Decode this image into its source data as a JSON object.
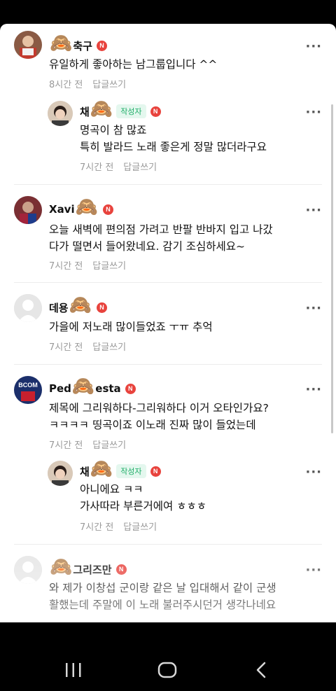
{
  "comments": [
    {
      "name_prefix": "",
      "name": "축구",
      "text": "유일하게 좋아하는 남그룹입니다 ^^",
      "time": "8시간 전",
      "reply": "답글쓰기"
    },
    {
      "name_prefix": "채",
      "name": "",
      "author_badge": "작성자",
      "text": "명곡이 참 많죠\n특히 발라드 노래 좋은게 정말 많더라구요",
      "time": "7시간 전",
      "reply": "답글쓰기"
    },
    {
      "name_prefix": "Xavi",
      "name": "",
      "text": "오늘 새벽에 편의점 가려고 반팔 반바지 입고 나갔\n다가 떨면서 들어왔네요. 감기 조심하세요~",
      "time": "7시간 전",
      "reply": "답글쓰기"
    },
    {
      "name_prefix": "데용",
      "name": "",
      "text": "가을에 저노래 많이들었죠 ㅜㅠ 추억",
      "time": "7시간 전",
      "reply": "답글쓰기"
    },
    {
      "name_prefix": "Ped",
      "name": "esta",
      "avatar_text": "BCOM",
      "text": "제목에 그리워하다-그리워하다 이거 오타인가요?\nㅋㅋㅋㅋ 띵곡이죠 이노래 진짜 많이 들었는데",
      "time": "7시간 전",
      "reply": "답글쓰기"
    },
    {
      "name_prefix": "채",
      "name": "",
      "author_badge": "작성자",
      "text": "아니에요 ㅋㅋ\n가사따라 부른거에여 ㅎㅎㅎ",
      "time": "7시간 전",
      "reply": "답글쓰기"
    },
    {
      "name_prefix": "",
      "name": "그리즈만",
      "text": "와 제가 이창섭 군이랑 같은 날 입대해서 같이 군생\n활했는데 주말에 이 노래 불러주시던거 생각나네요",
      "time": "",
      "reply": ""
    }
  ],
  "icons": {
    "monkey": "🙈",
    "n_badge": "N",
    "more": "···"
  },
  "colors": {
    "n_badge": "#e8433d",
    "author_badge_bg": "#e4f7ee",
    "author_badge_text": "#1fae68",
    "meta_text": "#9a9a9a"
  }
}
